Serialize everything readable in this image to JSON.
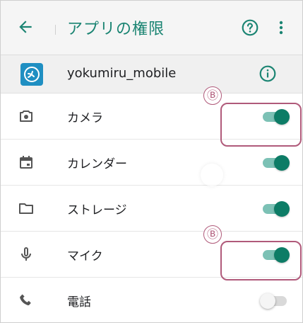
{
  "appbar": {
    "title": "アプリの権限"
  },
  "app": {
    "name": "yokumiru_mobile"
  },
  "permissions": [
    {
      "label": "カメラ",
      "enabled": true
    },
    {
      "label": "カレンダー",
      "enabled": true
    },
    {
      "label": "ストレージ",
      "enabled": true
    },
    {
      "label": "マイク",
      "enabled": true
    },
    {
      "label": "電話",
      "enabled": false
    }
  ],
  "callouts": [
    {
      "marker": "Ⓑ"
    },
    {
      "marker": "Ⓑ"
    }
  ],
  "colors": {
    "accent": "#1a8472",
    "toggle_on": "#0d7c66",
    "highlight": "#b05a7a"
  },
  "icons": [
    "back-arrow-icon",
    "help-icon",
    "more-vert-icon",
    "info-icon",
    "camera-icon",
    "calendar-icon",
    "folder-icon",
    "mic-icon",
    "phone-icon"
  ]
}
